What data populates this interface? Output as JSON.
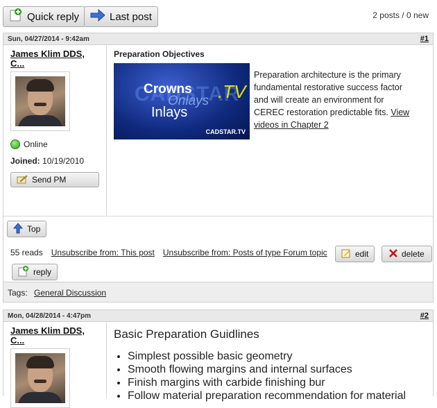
{
  "toolbar": {
    "quick_reply": "Quick reply",
    "last_post": "Last post",
    "posts_count": "2 posts / 0 new"
  },
  "post1": {
    "date": "Sun, 04/27/2014 - 9:42am",
    "number": "#1",
    "author": {
      "name": "James Klim DDS, C...",
      "status": "Online",
      "joined_label": "Joined:",
      "joined_date": "10/19/2010",
      "send_pm": "Send PM"
    },
    "title": "Preparation Objectives",
    "thumb": {
      "word1": "Crowns",
      "word2": "Onlays",
      "word3": "Inlays",
      "tv": ".TV",
      "logo": "CADSTAR.TV"
    },
    "description": "Preparation architecture is the primary fundamental restorative success factor and will create an environment for CEREC restoration predictable fits.",
    "link": "View videos in Chapter 2",
    "footer": {
      "top": "Top",
      "reads": "55 reads",
      "unsub_post": "Unsubscribe from: This post",
      "unsub_type": "Unsubscribe from: Posts of type Forum topic",
      "edit": "edit",
      "delete": "delete",
      "reply": "reply"
    }
  },
  "tags": {
    "label": "Tags:",
    "value": "General Discussion"
  },
  "post2": {
    "date": "Mon, 04/28/2014 - 4:47pm",
    "number": "#2",
    "author": {
      "name": "James Klim DDS, C..."
    },
    "title": "Basic Preparation Guidlines",
    "items": [
      "Simplest possible basic geometry",
      "Smooth flowing margins and internal surfaces",
      "Finish margins with carbide finishing bur",
      "Follow material preparation recommendation for material"
    ]
  },
  "colors": {
    "online": "#2f9e1f",
    "delete": "#cc1111",
    "arrow": "#3a6fd8"
  }
}
